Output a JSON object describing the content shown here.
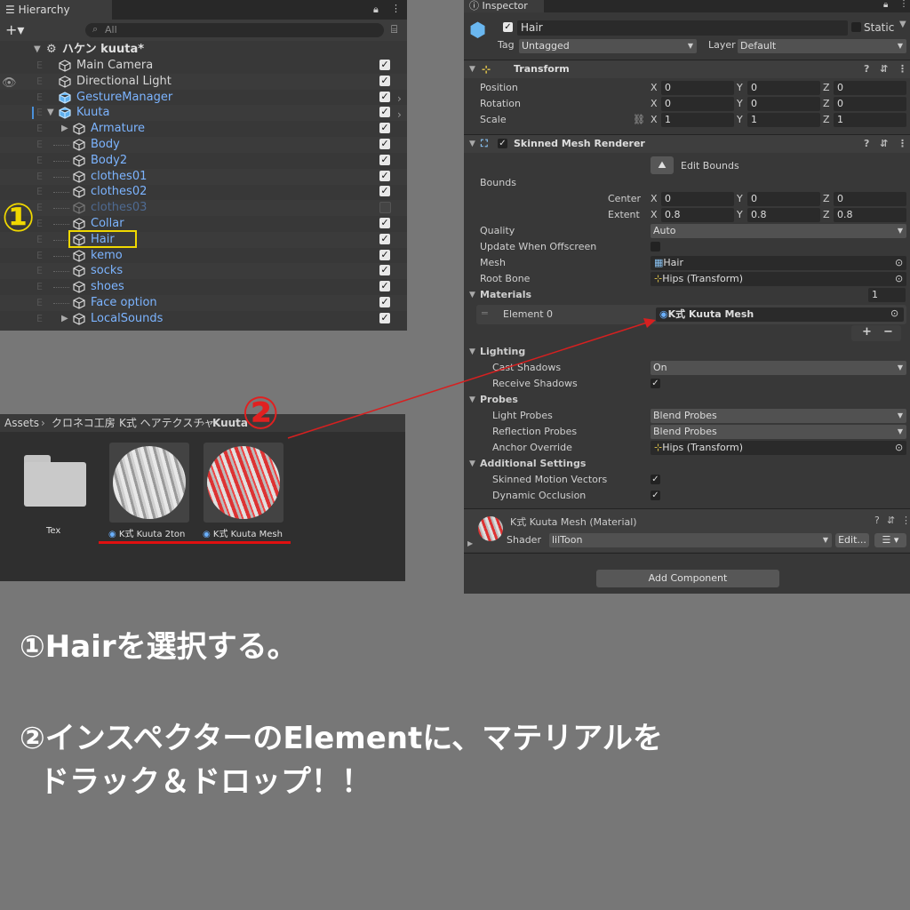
{
  "hierarchy": {
    "tab": "Hierarchy",
    "search_placeholder": "All",
    "scene": "ハケン kuuta*",
    "items": [
      {
        "name": "Main Camera",
        "depth": 1,
        "color": "#d6d6d6",
        "checked": true
      },
      {
        "name": "Directional Light",
        "depth": 1,
        "color": "#d6d6d6",
        "checked": true
      },
      {
        "name": "GestureManager",
        "depth": 1,
        "color": "#7cb4ff",
        "checked": true
      },
      {
        "name": "Kuuta",
        "depth": 1,
        "color": "#7cb4ff",
        "checked": true
      },
      {
        "name": "Armature",
        "depth": 2,
        "color": "#7cb4ff",
        "checked": true
      },
      {
        "name": "Body",
        "depth": 2,
        "color": "#7cb4ff",
        "checked": true
      },
      {
        "name": "Body2",
        "depth": 2,
        "color": "#7cb4ff",
        "checked": true
      },
      {
        "name": "clothes01",
        "depth": 2,
        "color": "#7cb4ff",
        "checked": true
      },
      {
        "name": "clothes02",
        "depth": 2,
        "color": "#7cb4ff",
        "checked": true
      },
      {
        "name": "clothes03",
        "depth": 2,
        "color": "#4e6a92",
        "checked": false
      },
      {
        "name": "Collar",
        "depth": 2,
        "color": "#7cb4ff",
        "checked": true
      },
      {
        "name": "Hair",
        "depth": 2,
        "color": "#7cb4ff",
        "checked": true
      },
      {
        "name": "kemo",
        "depth": 2,
        "color": "#7cb4ff",
        "checked": true
      },
      {
        "name": "socks",
        "depth": 2,
        "color": "#7cb4ff",
        "checked": true
      },
      {
        "name": "shoes",
        "depth": 2,
        "color": "#7cb4ff",
        "checked": true
      },
      {
        "name": "Face option",
        "depth": 2,
        "color": "#7cb4ff",
        "checked": true
      },
      {
        "name": "LocalSounds",
        "depth": 2,
        "color": "#7cb4ff",
        "checked": true
      }
    ]
  },
  "assets": {
    "breadcrumb": [
      "Assets",
      "クロネコ工房",
      "K式 ヘアテクスチャ",
      "Kuuta"
    ],
    "folder_label": "Tex",
    "materials": [
      "K式 Kuuta 2ton",
      "K式 Kuuta Mesh"
    ]
  },
  "inspector": {
    "tab": "Inspector",
    "object_name": "Hair",
    "static_label": "Static",
    "tag_label": "Tag",
    "tag_value": "Untagged",
    "layer_label": "Layer",
    "layer_value": "Default",
    "transform_title": "Transform",
    "position_label": "Position",
    "rotation_label": "Rotation",
    "scale_label": "Scale",
    "position": [
      "0",
      "0",
      "0"
    ],
    "rotation": [
      "0",
      "0",
      "0"
    ],
    "scale": [
      "1",
      "1",
      "1"
    ],
    "smr_title": "Skinned Mesh Renderer",
    "edit_bounds": "Edit Bounds",
    "bounds_label": "Bounds",
    "center_label": "Center",
    "extent_label": "Extent",
    "center": [
      "0",
      "0",
      "0"
    ],
    "extent": [
      "0.8",
      "0.8",
      "0.8"
    ],
    "quality_label": "Quality",
    "quality_value": "Auto",
    "update_offscreen_label": "Update When Offscreen",
    "mesh_label": "Mesh",
    "mesh_value": "Hair",
    "rootbone_label": "Root Bone",
    "rootbone_value": "Hips (Transform)",
    "materials_label": "Materials",
    "materials_count": "1",
    "element0_label": "Element 0",
    "element0_value": "K式  Kuuta Mesh",
    "lighting_label": "Lighting",
    "cast_shadows_label": "Cast Shadows",
    "cast_shadows_value": "On",
    "receive_shadows_label": "Receive Shadows",
    "probes_label": "Probes",
    "light_probes_label": "Light Probes",
    "light_probes_value": "Blend Probes",
    "reflection_probes_label": "Reflection Probes",
    "reflection_probes_value": "Blend Probes",
    "anchor_override_label": "Anchor Override",
    "anchor_override_value": "Hips (Transform)",
    "additional_label": "Additional Settings",
    "skinned_motion_label": "Skinned Motion Vectors",
    "dynamic_occlusion_label": "Dynamic Occlusion",
    "material_title": "K式  Kuuta Mesh (Material)",
    "shader_label": "Shader",
    "shader_value": "lilToon",
    "edit_label": "Edit...",
    "add_component": "Add Component"
  },
  "annotations": {
    "marker1": "①",
    "marker2": "②",
    "step1": "①Hairを選択する。",
    "step2_line1": "②インスペクターのElementに、マテリアルを",
    "step2_line2": "ドラック＆ドロップ！！"
  },
  "colors": {
    "highlight_yellow": "#f0d800",
    "arrow_red": "#d62020",
    "background": "#777777"
  }
}
